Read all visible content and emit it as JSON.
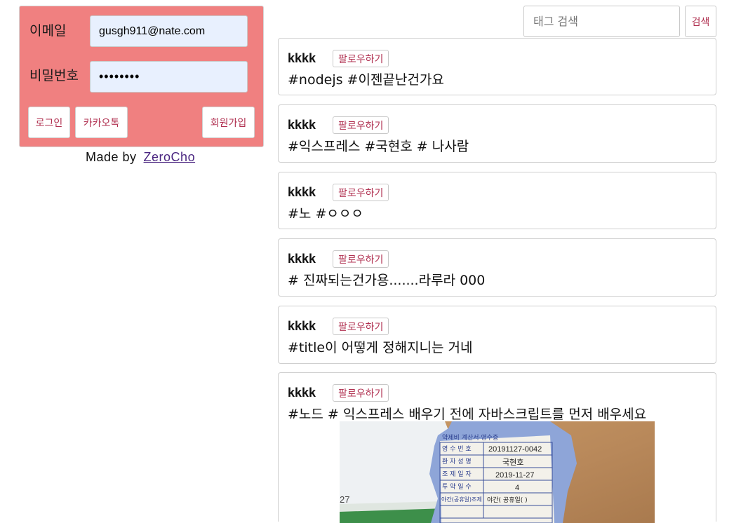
{
  "login": {
    "email_label": "이메일",
    "email_value": "gusgh911@nate.com",
    "password_label": "비밀번호",
    "password_value": "••••••••",
    "login_button": "로그인",
    "kakao_button": "카카오톡",
    "join_button": "회원가입"
  },
  "footer": {
    "made_by": "Made by",
    "author_link": "ZeroCho"
  },
  "search": {
    "placeholder": "태그 검색",
    "button": "검색"
  },
  "twits": [
    {
      "author": "kkkk",
      "follow": "팔로우하기",
      "content": "#nodejs #이젠끝난건가요"
    },
    {
      "author": "kkkk",
      "follow": "팔로우하기",
      "content": "#익스프레스 #국현호 # 나사람"
    },
    {
      "author": "kkkk",
      "follow": "팔로우하기",
      "content": "#노 #ㅇㅇㅇ"
    },
    {
      "author": "kkkk",
      "follow": "팔로우하기",
      "content": "# 진짜되는건가용.......라루라 000"
    },
    {
      "author": "kkkk",
      "follow": "팔로우하기",
      "content": "#title이 어떻게 정해지니는 거네"
    },
    {
      "author": "kkkk",
      "follow": "팔로우하기",
      "content": "#노드 # 익스프레스 배우기 전에 자바스크립트를 먼저 배우세요"
    }
  ],
  "receipt_image": {
    "header": "약제비 계산서·영수증",
    "rows": [
      {
        "label": "영 수 번 호",
        "value": "20191127-0042"
      },
      {
        "label": "환 자 성 명",
        "value": "국현호"
      },
      {
        "label": "조 제 일 자",
        "value": "2019-11-27"
      },
      {
        "label": "투 약 일 수",
        "value": "4"
      }
    ],
    "side_number": "27",
    "night_label": "야간(공휴일)조제",
    "night_value": "야간( 공휴일( )"
  }
}
